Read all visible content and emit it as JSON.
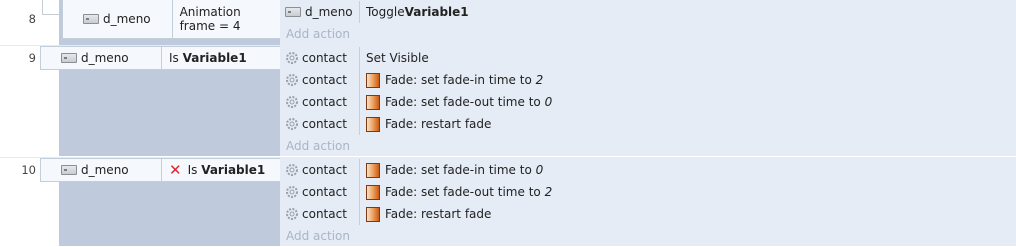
{
  "events": [
    {
      "number": "8",
      "conditions": [
        {
          "object": "d_meno",
          "text": "Animation frame = 4"
        }
      ],
      "actions": [
        {
          "object": "d_meno",
          "icon": "object-icon",
          "text_parts": [
            {
              "t": "Toggle ",
              "s": "normal"
            },
            {
              "t": "Variable1",
              "s": "bold"
            }
          ]
        }
      ],
      "add_action": "Add action"
    },
    {
      "number": "9",
      "conditions": [
        {
          "object": "d_meno",
          "inverted": false,
          "text_parts": [
            {
              "t": "Is ",
              "s": "normal"
            },
            {
              "t": "Variable1",
              "s": "bold"
            }
          ]
        }
      ],
      "actions": [
        {
          "object": "contact",
          "icon": "gear-icon",
          "behavior_icon": false,
          "text_parts": [
            {
              "t": "Set Visible",
              "s": "normal"
            }
          ]
        },
        {
          "object": "contact",
          "icon": "gear-icon",
          "behavior_icon": true,
          "text_parts": [
            {
              "t": "Fade: set fade-in time to ",
              "s": "normal"
            },
            {
              "t": "2",
              "s": "italic"
            }
          ]
        },
        {
          "object": "contact",
          "icon": "gear-icon",
          "behavior_icon": true,
          "text_parts": [
            {
              "t": "Fade: set fade-out time to ",
              "s": "normal"
            },
            {
              "t": "0",
              "s": "italic"
            }
          ]
        },
        {
          "object": "contact",
          "icon": "gear-icon",
          "behavior_icon": true,
          "text_parts": [
            {
              "t": "Fade: restart fade",
              "s": "normal"
            }
          ]
        }
      ],
      "add_action": "Add action"
    },
    {
      "number": "10",
      "conditions": [
        {
          "object": "d_meno",
          "inverted": true,
          "text_parts": [
            {
              "t": "Is ",
              "s": "normal"
            },
            {
              "t": "Variable1",
              "s": "bold"
            }
          ]
        }
      ],
      "actions": [
        {
          "object": "contact",
          "icon": "gear-icon",
          "behavior_icon": true,
          "text_parts": [
            {
              "t": "Fade: set fade-in time to ",
              "s": "normal"
            },
            {
              "t": "0",
              "s": "italic"
            }
          ]
        },
        {
          "object": "contact",
          "icon": "gear-icon",
          "behavior_icon": true,
          "text_parts": [
            {
              "t": "Fade: set fade-out time to ",
              "s": "normal"
            },
            {
              "t": "2",
              "s": "italic"
            }
          ]
        },
        {
          "object": "contact",
          "icon": "gear-icon",
          "behavior_icon": true,
          "text_parts": [
            {
              "t": "Fade: restart fade",
              "s": "normal"
            }
          ]
        }
      ],
      "add_action": "Add action"
    }
  ],
  "colors": {
    "condition_bg": "#bfcbdc",
    "action_bg": "#e6ecf5",
    "add_action_text": "#a9b5c8",
    "invert_mark": "#e0282e",
    "fade_icon": "#c85a14"
  }
}
